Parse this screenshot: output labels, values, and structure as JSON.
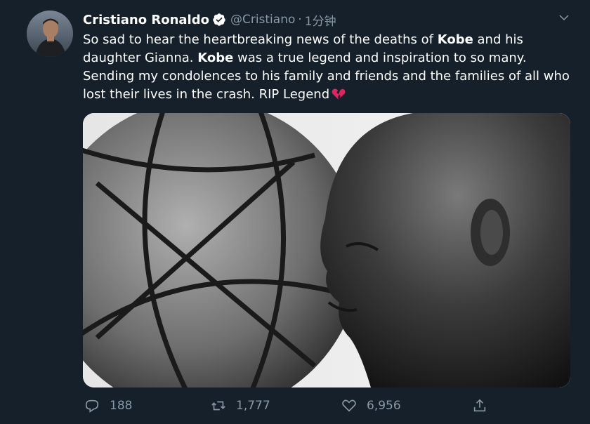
{
  "author": {
    "name": "Cristiano Ronaldo",
    "handle": "@Cristiano",
    "separator": "·",
    "time": "1分钟"
  },
  "tweet": {
    "text_parts": [
      "So sad to hear the heartbreaking news of the deaths of ",
      "Kobe",
      " and his daughter Gianna. ",
      "Kobe",
      " was a true legend and inspiration to so many. Sending my condolences to his family and friends and the families of all who lost their lives in the crash. RIP Legend"
    ]
  },
  "actions": {
    "replies": "188",
    "retweets": "1,777",
    "likes": "6,956"
  },
  "icons": {
    "verified": "verified-badge-icon",
    "caret": "chevron-down-icon",
    "reply": "reply-icon",
    "retweet": "retweet-icon",
    "like": "heart-icon",
    "share": "share-icon",
    "broken_heart": "broken-heart-emoji"
  },
  "colors": {
    "background": "#15202b",
    "secondary_text": "#8899a6",
    "verified_blue": "#1da1f2",
    "broken_heart_red": "#e0245e"
  }
}
